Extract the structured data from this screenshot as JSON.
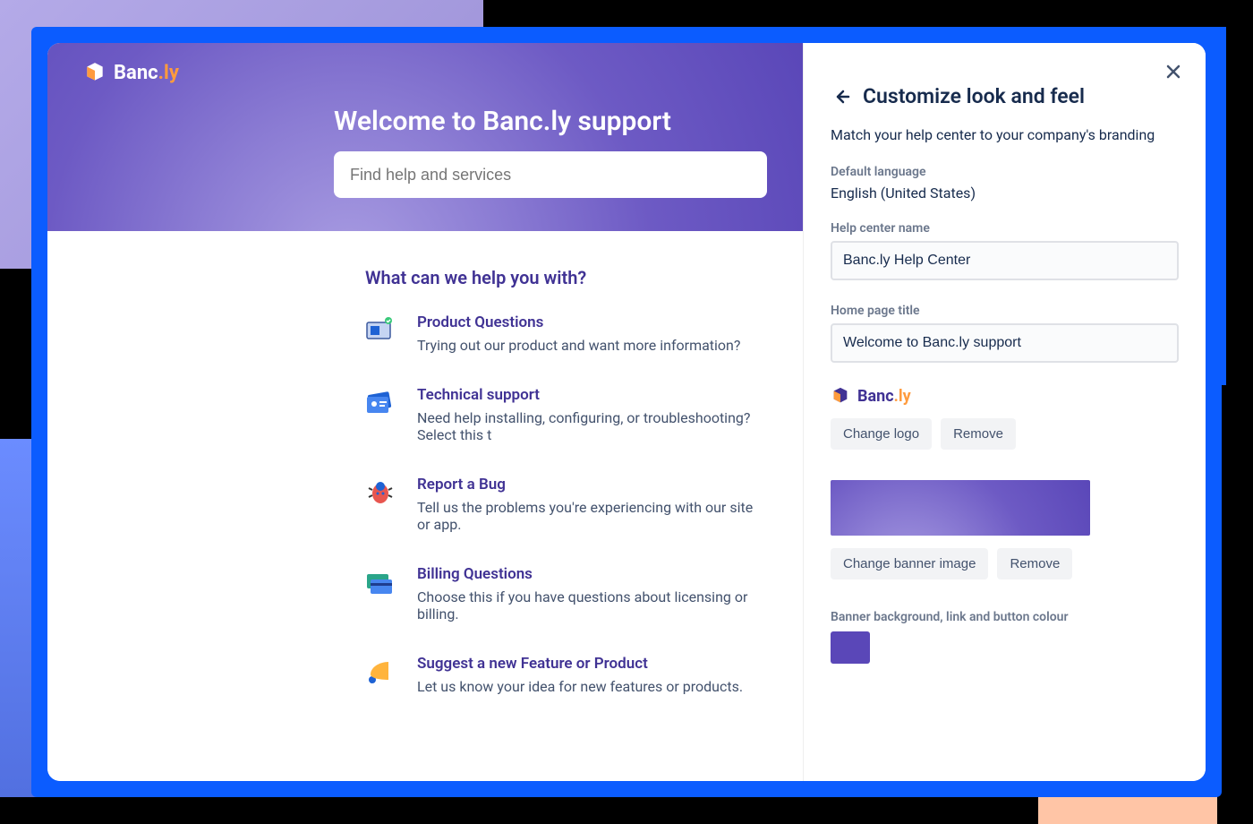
{
  "brand": {
    "name": "Banc",
    "suffix": ".ly"
  },
  "hero": {
    "title": "Welcome to Banc.ly support",
    "search_placeholder": "Find help and services"
  },
  "section_title": "What can we help you with?",
  "topics": [
    {
      "title": "Product Questions",
      "desc": "Trying out our product and want more information?"
    },
    {
      "title": "Technical support",
      "desc": "Need help installing, configuring, or troubleshooting? Select this t"
    },
    {
      "title": "Report a Bug",
      "desc": "Tell us the problems you're experiencing with our site or app."
    },
    {
      "title": "Billing Questions",
      "desc": "Choose this if you have questions about licensing or billing."
    },
    {
      "title": "Suggest a new Feature or Product",
      "desc": "Let us know your idea for new features or products."
    }
  ],
  "panel": {
    "title": "Customize look and feel",
    "subtitle": "Match your help center to your company's branding",
    "default_lang_label": "Default language",
    "default_lang_value": "English (United States)",
    "name_label": "Help center name",
    "name_value": "Banc.ly Help Center",
    "title_label": "Home page title",
    "title_value": "Welcome to Banc.ly support",
    "change_logo": "Change logo",
    "remove_logo": "Remove",
    "change_banner": "Change banner image",
    "remove_banner": "Remove",
    "color_label": "Banner background, link and button colour",
    "accent_color": "#5a47b8"
  }
}
